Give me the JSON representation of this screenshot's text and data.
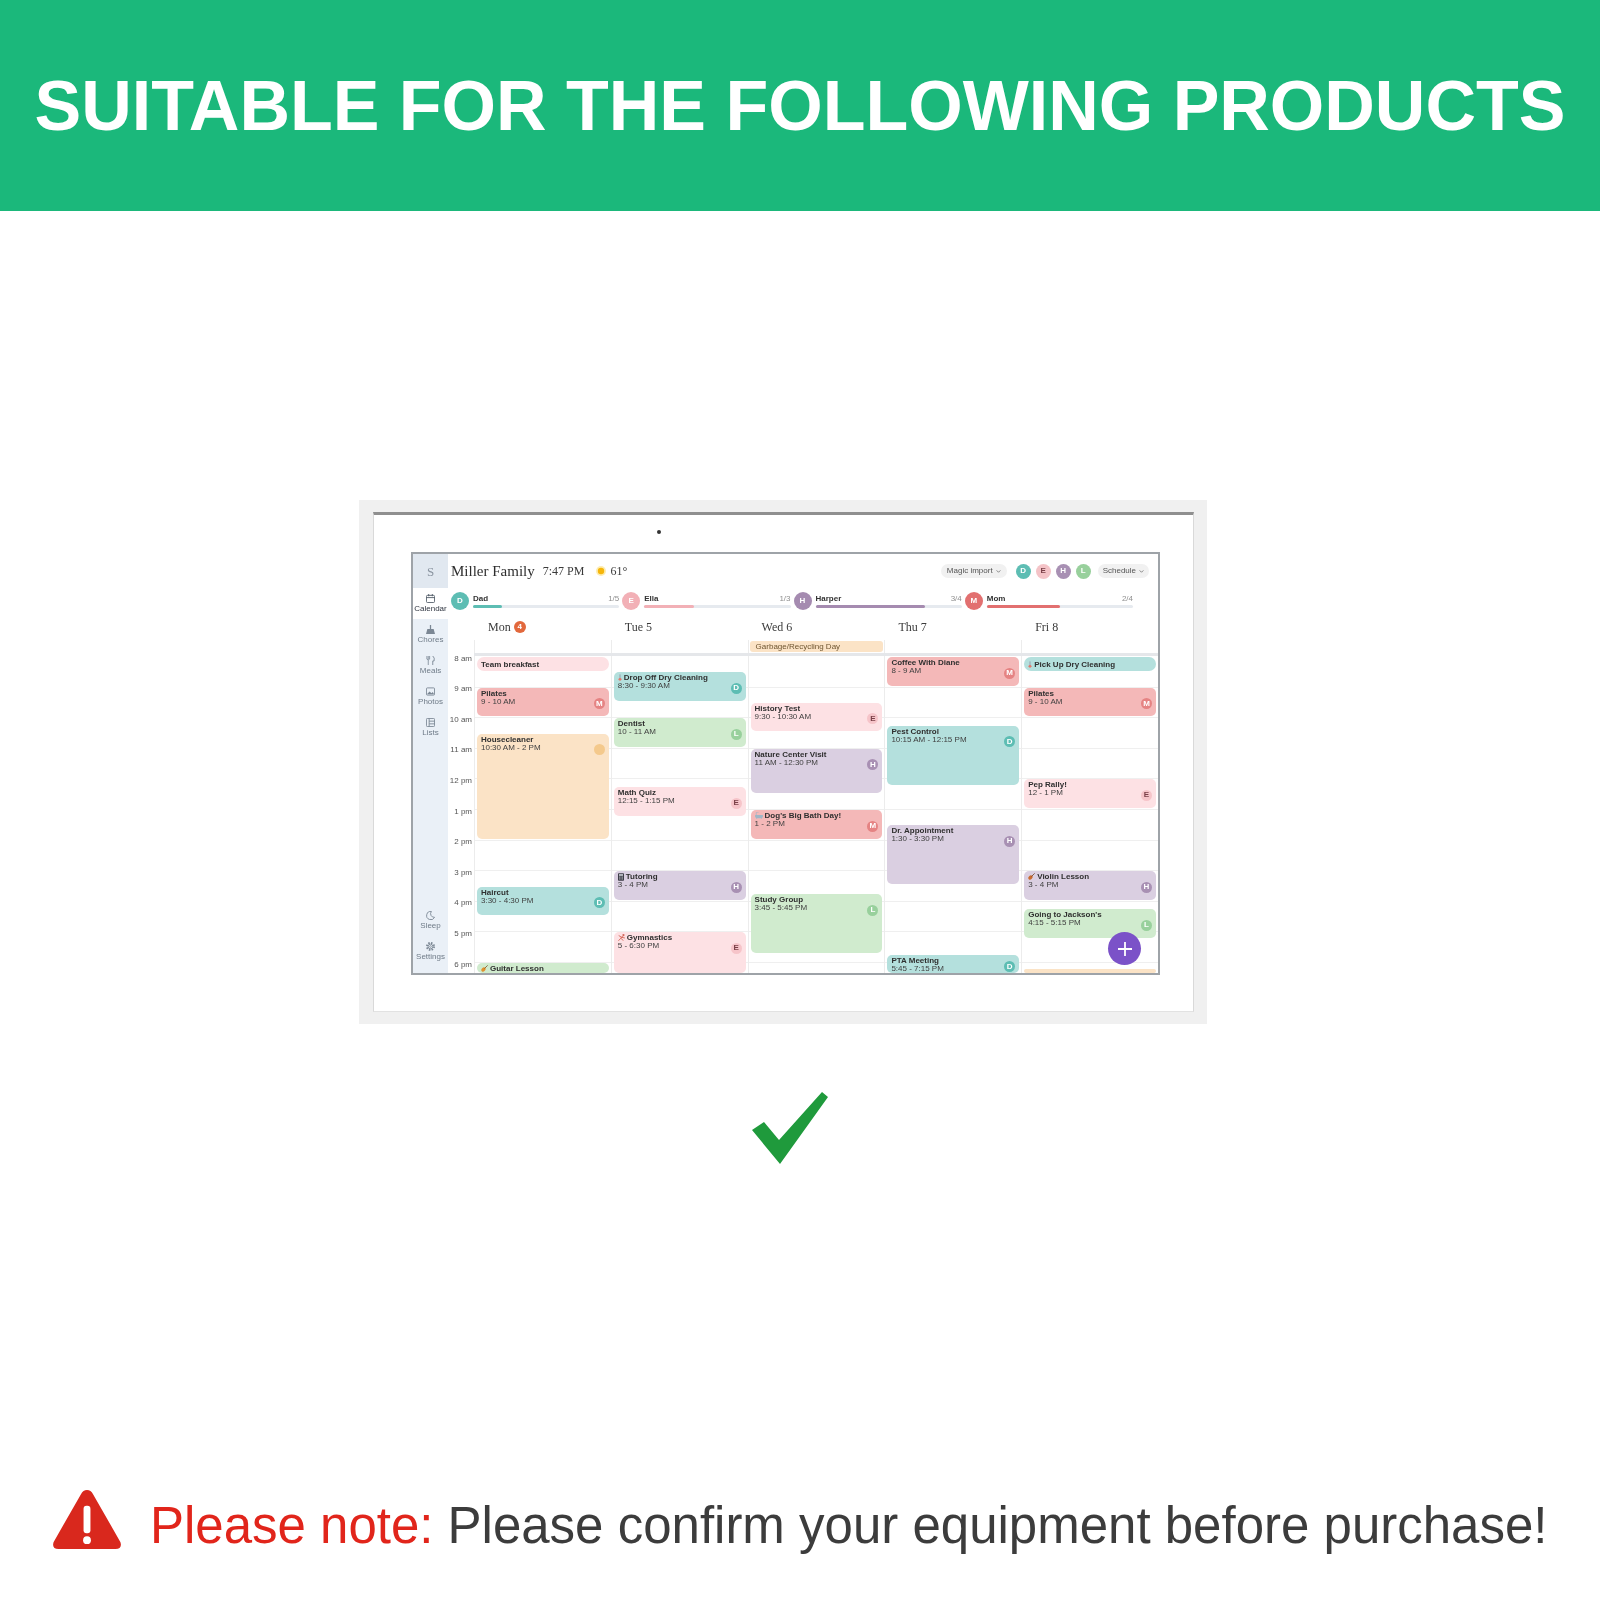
{
  "banner": {
    "title": "SUITABLE FOR THE FOLLOWING PRODUCTS"
  },
  "calendar_app": {
    "logo": "S",
    "nav": [
      {
        "label": "Calendar",
        "kind": "calendar",
        "selected": true
      },
      {
        "label": "Chores",
        "kind": "chores",
        "selected": false
      },
      {
        "label": "Meals",
        "kind": "meals",
        "selected": false
      },
      {
        "label": "Photos",
        "kind": "photos",
        "selected": false
      },
      {
        "label": "Lists",
        "kind": "lists",
        "selected": false
      }
    ],
    "nav_bottom": [
      {
        "label": "Sleep",
        "kind": "sleep",
        "selected": false
      },
      {
        "label": "Settings",
        "kind": "settings",
        "selected": false
      }
    ],
    "header": {
      "title": "Miller Family",
      "time": "7:47 PM",
      "temperature": "61°"
    },
    "import_button": {
      "label": "Magic import"
    },
    "profiles": [
      {
        "letter": "D",
        "color": "#5dbdb3"
      },
      {
        "letter": "E",
        "color": "#f4c3c7"
      },
      {
        "letter": "H",
        "color": "#a890b3"
      },
      {
        "letter": "L",
        "color": "#98d09c"
      }
    ],
    "view_button": {
      "label": "Schedule"
    },
    "members": [
      {
        "letter": "D",
        "name": "Dad",
        "count": "1/5",
        "level": 0.2,
        "color": "#5dbdb3"
      },
      {
        "letter": "E",
        "name": "Ella",
        "count": "1/3",
        "level": 0.34,
        "color": "#f2b0b6"
      },
      {
        "letter": "H",
        "name": "Harper",
        "count": "3/4",
        "level": 0.75,
        "color": "#a58bb0"
      },
      {
        "letter": "M",
        "name": "Mom",
        "count": "2/4",
        "level": 0.5,
        "color": "#e27070"
      }
    ],
    "hours": [
      "8 am",
      "9 am",
      "10 am",
      "11 am",
      "12 pm",
      "1 pm",
      "2 pm",
      "3 pm",
      "4 pm",
      "5 pm",
      "6 pm"
    ],
    "days": [
      {
        "label": "Mon",
        "badge": "4",
        "reminders": [
          {
            "kind": "plain",
            "title": "Team breakfast",
            "color": "#fde1e4"
          }
        ],
        "events": [
          {
            "kind": "plain",
            "title": "Pilates",
            "time": "9 - 10 AM",
            "color": "#f4b8b8",
            "avatar": {
              "letter": "M",
              "color": "#e58383"
            }
          },
          {
            "kind": "plain",
            "title": "Housecleaner",
            "time": "10:30 AM - 2 PM",
            "color": "#fbe3c6",
            "avatar": {
              "color": "#f4c98c"
            }
          },
          {
            "kind": "plain",
            "title": "Haircut",
            "time": "3:30 - 4:30 PM",
            "color": "#b4e0dd",
            "avatar": {
              "letter": "D",
              "color": "#5dbdb3"
            }
          }
        ],
        "edge_events": [
          {
            "kind": "guitar",
            "title": "Guitar Lesson",
            "color": "#d0ebce"
          }
        ]
      },
      {
        "label": "Tue 5",
        "events": [
          {
            "kind": "thermometer",
            "title": "Drop Off Dry Cleaning",
            "time": "8:30 - 9:30 AM",
            "color": "#b4e0dd",
            "avatar": {
              "letter": "D",
              "color": "#5dbdb3"
            }
          },
          {
            "kind": "plain",
            "title": "Dentist",
            "time": "10 - 11 AM",
            "color": "#d0ebce",
            "avatar": {
              "letter": "L",
              "color": "#98d09c"
            }
          },
          {
            "kind": "plain",
            "title": "Math Quiz",
            "time": "12:15 - 1:15 PM",
            "color": "#fde1e4",
            "avatar": {
              "letter": "E",
              "color": "#f6c4c9"
            }
          },
          {
            "kind": "calculator",
            "title": "Tutoring",
            "time": "3 - 4 PM",
            "color": "#dacfe1",
            "avatar": {
              "letter": "H",
              "color": "#a890b3"
            }
          },
          {
            "kind": "gymnast",
            "title": "Gymnastics",
            "time": "5 - 6:30 PM",
            "color": "#fde1e4",
            "avatar": {
              "letter": "E",
              "color": "#f6c4c9"
            }
          }
        ]
      },
      {
        "label": "Wed 6",
        "all_day": [
          {
            "title": "Garbage/Recycling Day",
            "color": "#fbe3c6"
          }
        ],
        "events": [
          {
            "kind": "plain",
            "title": "History Test",
            "time": "9:30 - 10:30 AM",
            "color": "#fde1e4",
            "avatar": {
              "letter": "E",
              "color": "#f6c4c9"
            }
          },
          {
            "kind": "plain",
            "title": "Nature Center Visit",
            "time": "11 AM - 12:30 PM",
            "color": "#dacfe1",
            "avatar": {
              "letter": "H",
              "color": "#a890b3"
            }
          },
          {
            "kind": "bath",
            "title": "Dog's Big Bath Day!",
            "time": "1 - 2 PM",
            "color": "#f4b8b8",
            "avatar": {
              "letter": "M",
              "color": "#e58383"
            }
          },
          {
            "kind": "plain",
            "title": "Study Group",
            "time": "3:45 - 5:45 PM",
            "color": "#d0ebce",
            "avatar": {
              "letter": "L",
              "color": "#98d09c"
            }
          }
        ]
      },
      {
        "label": "Thu 7",
        "events": [
          {
            "kind": "plain",
            "title": "Coffee With Diane",
            "time": "8 - 9 AM",
            "color": "#f4b8b8",
            "avatar": {
              "letter": "M",
              "color": "#e58383"
            }
          },
          {
            "kind": "plain",
            "title": "Pest Control",
            "time": "10:15 AM - 12:15 PM",
            "color": "#b4e0dd",
            "avatar": {
              "letter": "D",
              "color": "#5dbdb3"
            }
          },
          {
            "kind": "plain",
            "title": "Dr. Appointment",
            "time": "1:30 - 3:30 PM",
            "color": "#dacfe1",
            "avatar": {
              "letter": "H",
              "color": "#a890b3"
            }
          },
          {
            "kind": "plain",
            "title": "PTA Meeting",
            "time": "5:45 - 7:15 PM",
            "color": "#b4e0dd",
            "avatar": {
              "letter": "D",
              "color": "#5dbdb3"
            }
          }
        ]
      },
      {
        "label": "Fri 8",
        "reminders": [
          {
            "kind": "thermometer",
            "title": "Pick Up Dry Cleaning",
            "color": "#b4e0dd"
          }
        ],
        "events": [
          {
            "kind": "plain",
            "title": "Pilates",
            "time": "9 - 10 AM",
            "color": "#f4b8b8",
            "avatar": {
              "letter": "M",
              "color": "#e58383"
            }
          },
          {
            "kind": "plain",
            "title": "Pep Rally!",
            "time": "12 - 1 PM",
            "color": "#fde1e4",
            "avatar": {
              "letter": "E",
              "color": "#f6c4c9"
            }
          },
          {
            "kind": "violin",
            "title": "Violin Lesson",
            "time": "3 - 4 PM",
            "color": "#dacfe1",
            "avatar": {
              "letter": "H",
              "color": "#a890b3"
            }
          },
          {
            "kind": "plain",
            "title": "Going to Jackson's",
            "time": "4:15 - 5:15 PM",
            "color": "#d0ebce",
            "avatar": {
              "letter": "L",
              "color": "#98d09c"
            }
          }
        ],
        "edge_events": [
          {
            "kind": "plain",
            "color": "#fbe3c6"
          }
        ]
      }
    ]
  },
  "note": {
    "label": "Please note:",
    "message": "Please confirm your equipment before purchase!"
  }
}
